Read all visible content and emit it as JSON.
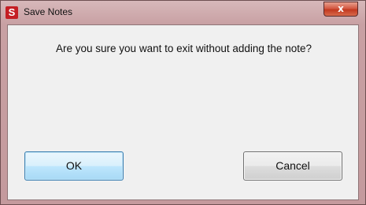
{
  "window": {
    "title": "Save Notes",
    "app_icon_letter": "S",
    "close_glyph": "x"
  },
  "dialog": {
    "message": "Are you sure you want to exit without adding the note?",
    "ok_label": "OK",
    "cancel_label": "Cancel"
  },
  "colors": {
    "frame": "#c8a0a3",
    "client_bg": "#f0f0f0",
    "app_icon": "#c41e24",
    "close_button": "#c2391f",
    "ok_button_border": "#3c7fb1"
  }
}
